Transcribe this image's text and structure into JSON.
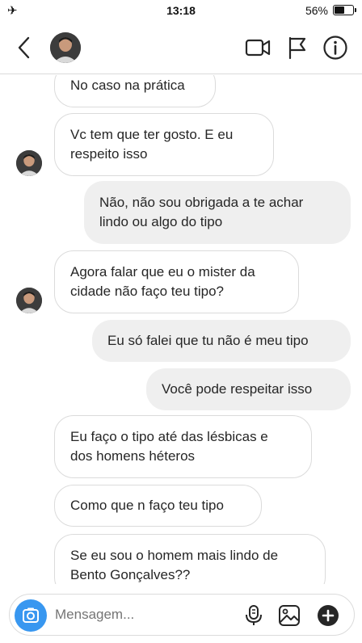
{
  "status_bar": {
    "airplane_icon": "airplane-icon",
    "time": "13:18",
    "battery_percent_text": "56%",
    "battery_level": 0.56
  },
  "header": {
    "back_icon": "chevron-left-icon",
    "video_icon": "video-camera-icon",
    "flag_icon": "flag-icon",
    "info_icon": "info-icon"
  },
  "messages": [
    {
      "direction": "in",
      "text": "No caso na prática"
    },
    {
      "direction": "in",
      "line1": "Vc tem que ter gosto. E eu",
      "line2": "respeito isso"
    },
    {
      "direction": "out",
      "line1": "Não, não sou obrigada a te achar",
      "line2": "lindo ou algo do tipo"
    },
    {
      "direction": "in",
      "line1": "Agora falar que eu o mister da",
      "line2": "cidade  não faço teu tipo?"
    },
    {
      "direction": "out",
      "text": "Eu só falei que tu não é meu tipo"
    },
    {
      "direction": "out",
      "text": "Você pode respeitar isso"
    },
    {
      "direction": "in",
      "line1": "Eu faço o tipo até das lésbicas e",
      "line2": "dos homens héteros"
    },
    {
      "direction": "in",
      "text": "Como que n faço teu tipo"
    },
    {
      "direction": "in",
      "line1": "Se eu sou o homem mais lindo de",
      "line2": "Bento Gonçalves??"
    }
  ],
  "composer": {
    "placeholder": "Mensagem...",
    "camera_icon": "camera-icon",
    "mic_icon": "microphone-icon",
    "gallery_icon": "gallery-icon",
    "plus_icon": "plus-icon"
  },
  "colors": {
    "accent_blue": "#3897f0",
    "outgoing_bubble": "#efefef",
    "incoming_border": "#dbdbdb",
    "text": "#262626"
  }
}
